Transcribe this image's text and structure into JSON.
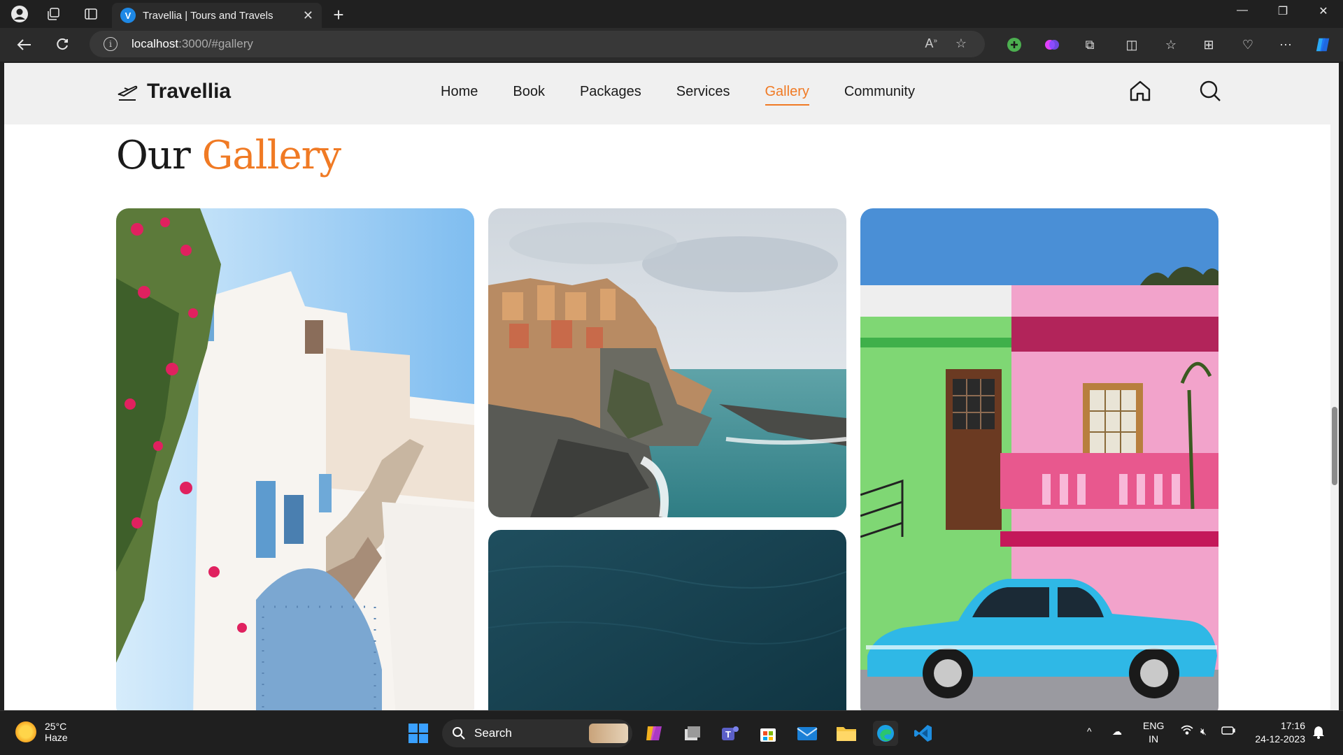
{
  "browser": {
    "tab_title": "Travellia | Tours and Travels",
    "tab_favicon_letter": "V",
    "address_host": "localhost",
    "address_path": ":3000/#gallery"
  },
  "site": {
    "brand": "Travellia",
    "menu": [
      {
        "label": "Home"
      },
      {
        "label": "Book"
      },
      {
        "label": "Packages"
      },
      {
        "label": "Services"
      },
      {
        "label": "Gallery",
        "active": true
      },
      {
        "label": "Community"
      }
    ],
    "accent_color": "#f07a24"
  },
  "gallery": {
    "title_part1": "Our",
    "title_part2": "Gallery"
  },
  "taskbar": {
    "temp": "25°C",
    "condition": "Haze",
    "search_label": "Search",
    "lang_line1": "ENG",
    "lang_line2": "IN",
    "time": "17:16",
    "date": "24-12-2023"
  }
}
